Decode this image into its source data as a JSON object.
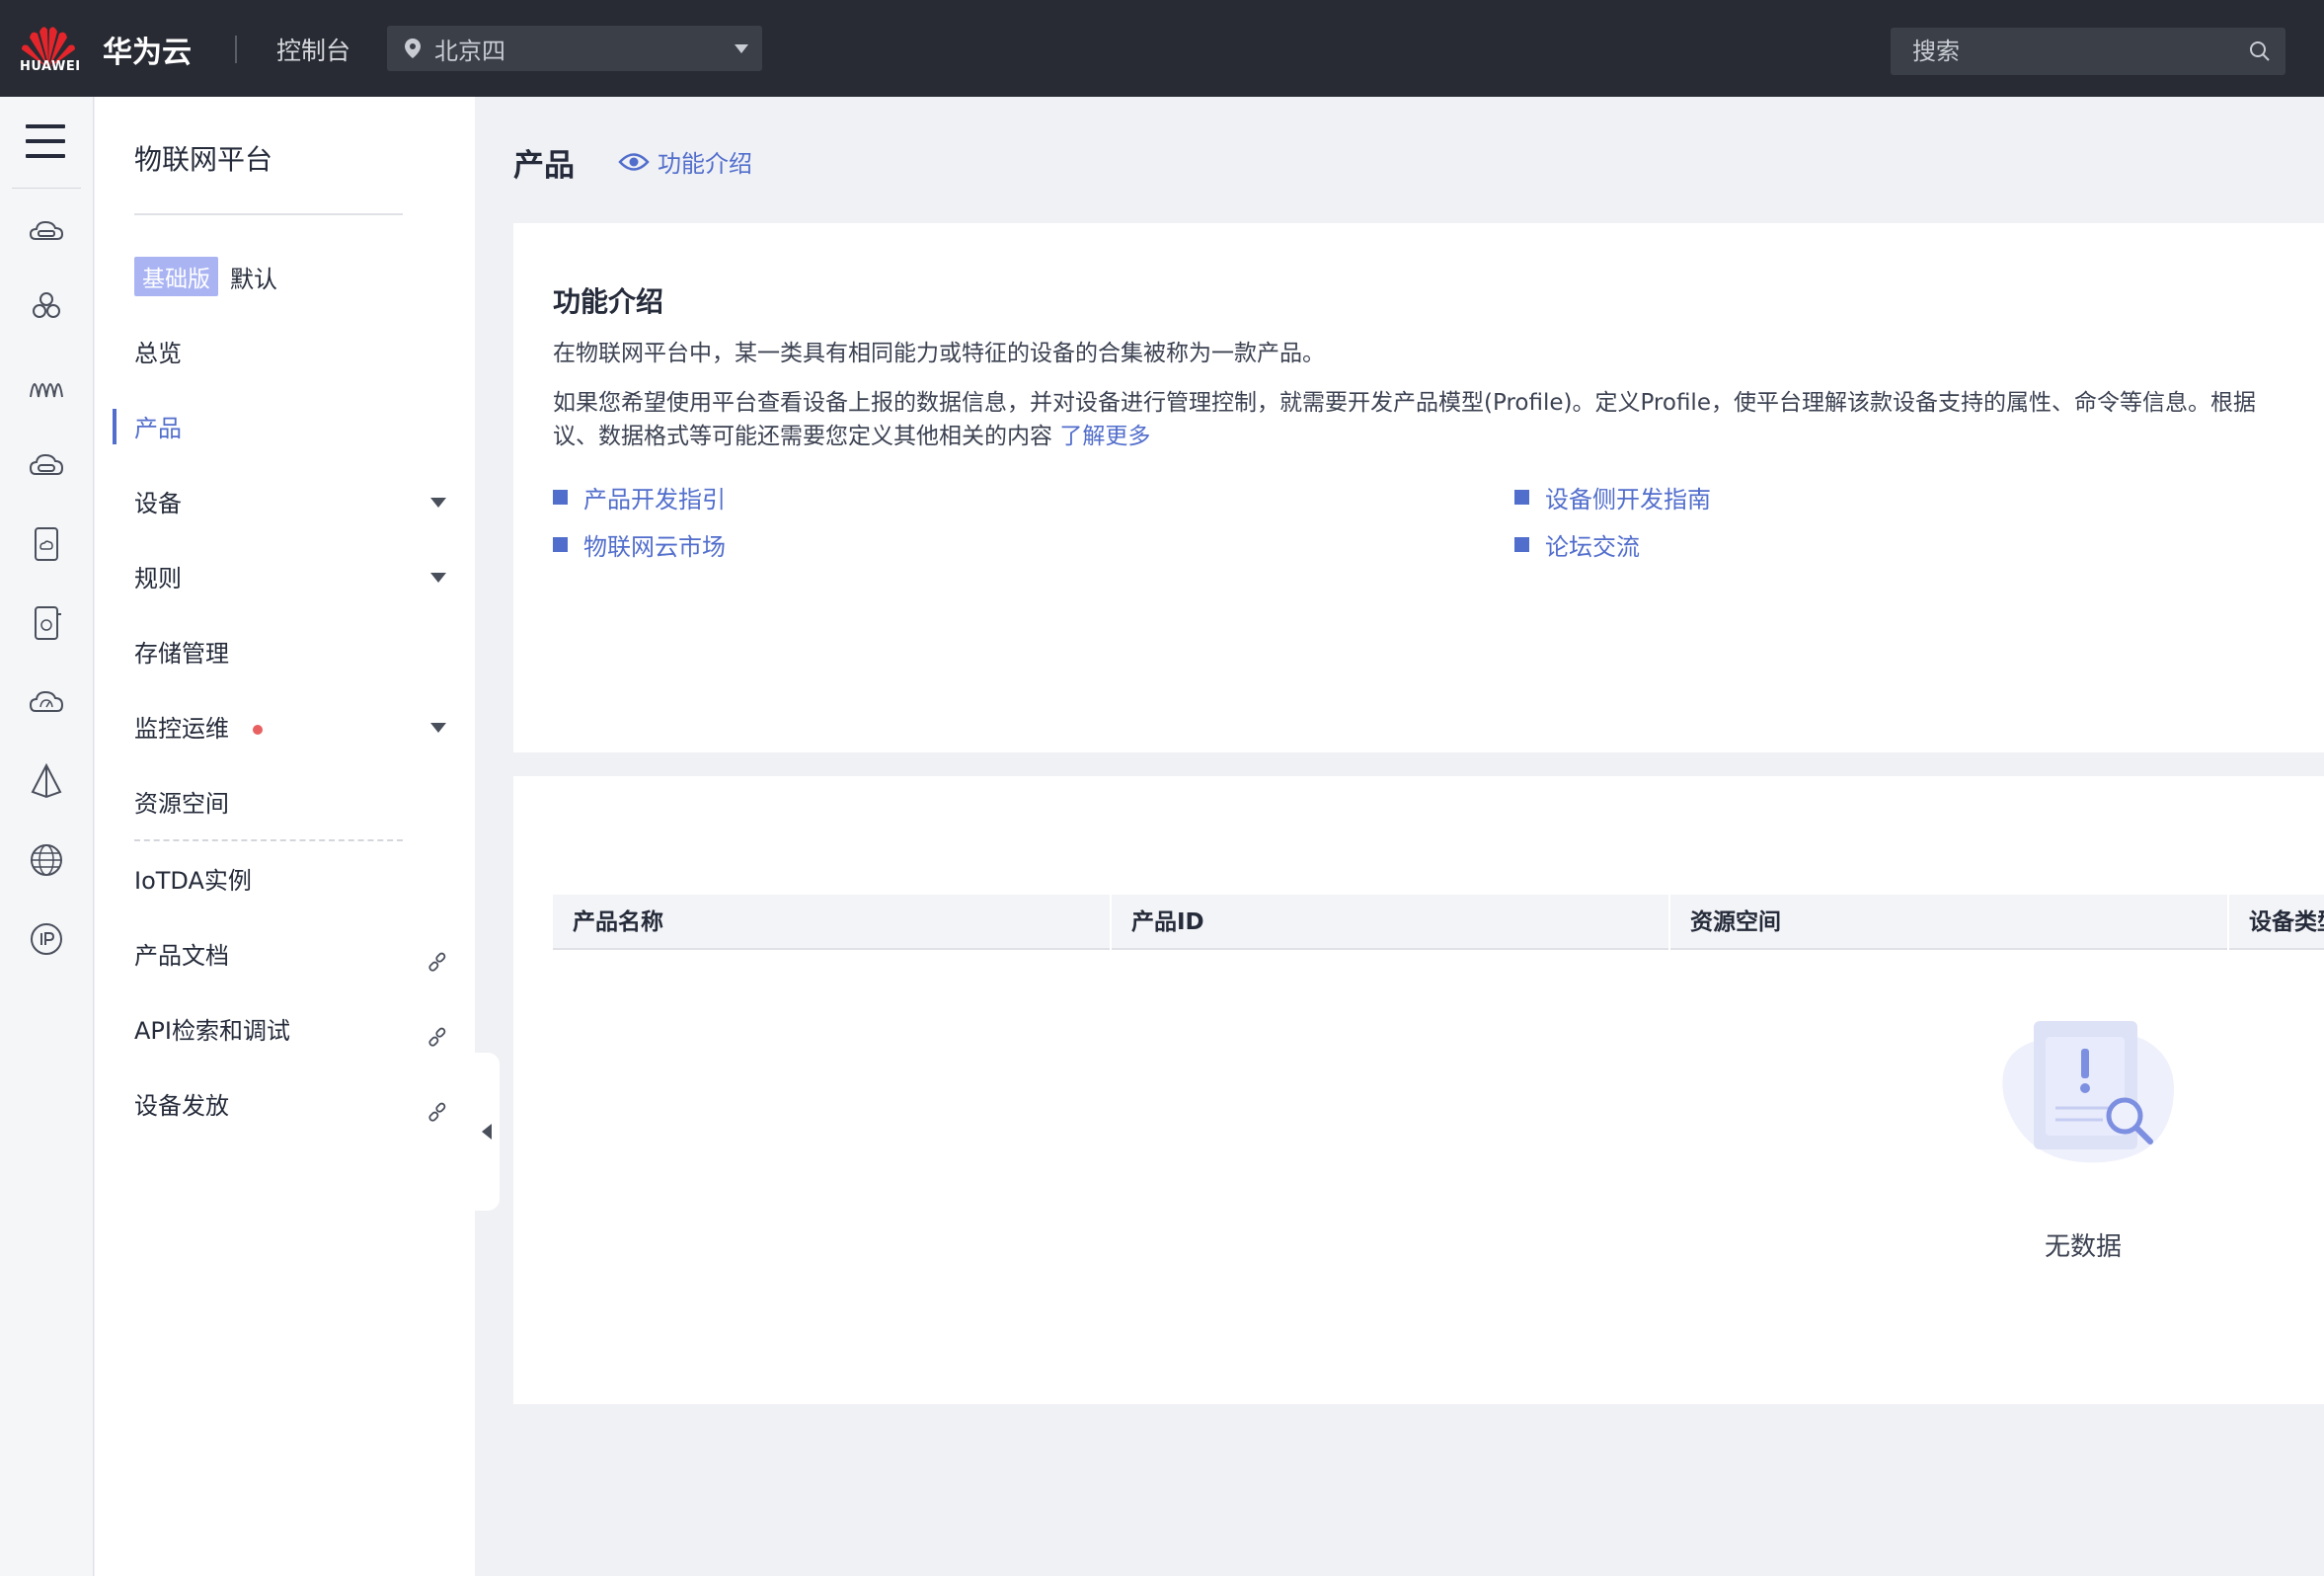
{
  "topbar": {
    "logo_text": "HUAWEI",
    "brand": "华为云",
    "console": "控制台",
    "region": "北京四",
    "search_placeholder": "搜索"
  },
  "rail": {
    "icons": [
      "cloud-server-icon",
      "cluster-icon",
      "waves-icon",
      "cloud-device-icon",
      "sd-card-icon",
      "device-card-icon",
      "cloud-monitor-icon",
      "prism-icon",
      "globe-icon",
      "ip-icon"
    ]
  },
  "sidebar": {
    "title": "物联网平台",
    "edition_badge": "基础版",
    "edition_name": "默认",
    "items": [
      {
        "label": "总览"
      },
      {
        "label": "产品"
      },
      {
        "label": "设备"
      },
      {
        "label": "规则"
      },
      {
        "label": "存储管理"
      },
      {
        "label": "监控运维"
      },
      {
        "label": "资源空间"
      },
      {
        "label": "IoTDA实例"
      },
      {
        "label": "产品文档"
      },
      {
        "label": "API检索和调试"
      },
      {
        "label": "设备发放"
      }
    ]
  },
  "main": {
    "title": "产品",
    "intro_link": "功能介绍",
    "intro": {
      "title": "功能介绍",
      "line1": "在物联网平台中，某一类具有相同能力或特征的设备的合集被称为一款产品。",
      "line2": "如果您希望使用平台查看设备上报的数据信息，并对设备进行管理控制，就需要开发产品模型(Profile)。定义Profile，使平台理解该款设备支持的属性、命令等信息。根据",
      "line3": "议、数据格式等可能还需要您定义其他相关的内容",
      "more": "了解更多",
      "links": [
        "产品开发指引",
        "设备侧开发指南",
        "物联网云市场",
        "论坛交流"
      ]
    },
    "table": {
      "columns": [
        "产品名称",
        "产品ID",
        "资源空间",
        "设备类型"
      ],
      "empty_text": "无数据"
    }
  },
  "colors": {
    "topbar": "#282b33",
    "accent": "#526ecc",
    "badge": "#aab4f3",
    "alert_dot": "#e86060"
  }
}
